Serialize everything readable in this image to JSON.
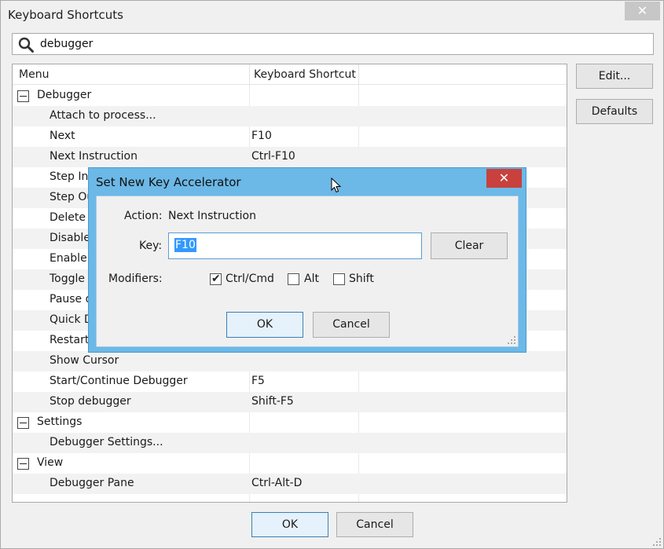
{
  "window": {
    "title": "Keyboard Shortcuts",
    "close_glyph": "✕"
  },
  "search": {
    "value": "debugger",
    "icon": "search-icon"
  },
  "tree": {
    "columns": [
      "Menu",
      "Keyboard Shortcut"
    ],
    "rows": [
      {
        "type": "group",
        "menu": "Debugger",
        "key": ""
      },
      {
        "type": "child",
        "menu": "Attach to process...",
        "key": ""
      },
      {
        "type": "child",
        "menu": "Next",
        "key": "F10"
      },
      {
        "type": "child",
        "menu": "Next Instruction",
        "key": "Ctrl-F10"
      },
      {
        "type": "child",
        "menu": "Step Int",
        "key": ""
      },
      {
        "type": "child",
        "menu": "Step Ou",
        "key": ""
      },
      {
        "type": "child",
        "menu": "Delete A",
        "key": ""
      },
      {
        "type": "child",
        "menu": "Disable",
        "key": ""
      },
      {
        "type": "child",
        "menu": "Enable A",
        "key": ""
      },
      {
        "type": "child",
        "menu": "Toggle",
        "key": ""
      },
      {
        "type": "child",
        "menu": "Pause d",
        "key": ""
      },
      {
        "type": "child",
        "menu": "Quick D",
        "key": ""
      },
      {
        "type": "child",
        "menu": "Restart",
        "key": ""
      },
      {
        "type": "child",
        "menu": "Show Cursor",
        "key": ""
      },
      {
        "type": "child",
        "menu": "Start/Continue Debugger",
        "key": "F5"
      },
      {
        "type": "child",
        "menu": "Stop debugger",
        "key": "Shift-F5"
      },
      {
        "type": "group",
        "menu": "Settings",
        "key": ""
      },
      {
        "type": "child",
        "menu": "Debugger Settings...",
        "key": ""
      },
      {
        "type": "group",
        "menu": "View",
        "key": ""
      },
      {
        "type": "child",
        "menu": "Debugger Pane",
        "key": "Ctrl-Alt-D"
      }
    ]
  },
  "side_buttons": {
    "edit": "Edit...",
    "defaults": "Defaults"
  },
  "footer": {
    "ok": "OK",
    "cancel": "Cancel"
  },
  "dialog": {
    "title": "Set New Key Accelerator",
    "close_glyph": "✕",
    "action_label": "Action:",
    "action_value": "Next Instruction",
    "key_label": "Key:",
    "key_value": "F10",
    "clear": "Clear",
    "modifiers_label": "Modifiers:",
    "modifiers": [
      {
        "label": "Ctrl/Cmd",
        "checked": true
      },
      {
        "label": "Alt",
        "checked": false
      },
      {
        "label": "Shift",
        "checked": false
      }
    ],
    "ok": "OK",
    "cancel": "Cancel"
  },
  "colors": {
    "dialog_frame": "#6cb8e6",
    "dialog_close": "#c8413d",
    "selection": "#3399ff",
    "default_button_border": "#3c7fb1"
  }
}
